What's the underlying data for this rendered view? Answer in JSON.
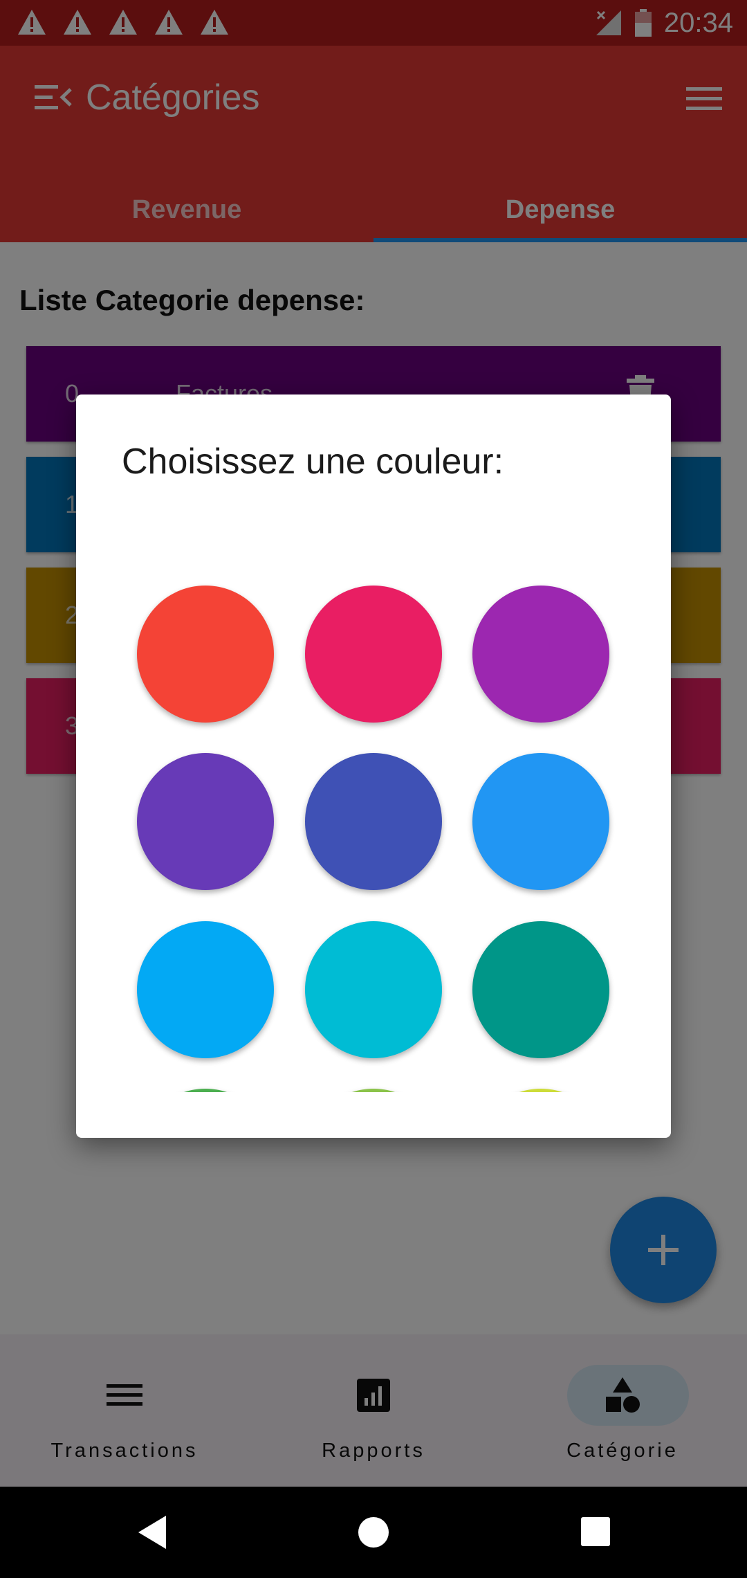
{
  "status_bar": {
    "time": "20:34"
  },
  "app_bar": {
    "title": "Catégories"
  },
  "tabs": [
    {
      "label": "Revenue",
      "selected": false
    },
    {
      "label": "Depense",
      "selected": true
    }
  ],
  "content": {
    "heading": "Liste Categorie depense:",
    "categories": [
      {
        "index": "0",
        "name": "Factures",
        "color": "#6a0080"
      },
      {
        "index": "1",
        "name": "",
        "color": "#0277bd"
      },
      {
        "index": "2",
        "name": "",
        "color": "#c49000"
      },
      {
        "index": "3",
        "name": "",
        "color": "#e91e63"
      }
    ]
  },
  "dialog": {
    "title": "Choisissez une couleur:",
    "colors": [
      "#f44336",
      "#e91e63",
      "#9c27b0",
      "#673ab7",
      "#3f51b5",
      "#2196f3",
      "#03a9f4",
      "#00bcd4",
      "#009688",
      "#4caf50",
      "#8bc34a",
      "#cddc39"
    ]
  },
  "bottom_nav": [
    {
      "label": "Transactions",
      "icon": "list-icon",
      "selected": false
    },
    {
      "label": "Rapports",
      "icon": "report-icon",
      "selected": false
    },
    {
      "label": "Catégorie",
      "icon": "category-shapes-icon",
      "selected": true
    }
  ],
  "fab": {
    "icon": "plus-icon"
  },
  "colors": {
    "primary": "#e53935",
    "accent": "#2196f3",
    "status_bar": "#b71c1c"
  }
}
